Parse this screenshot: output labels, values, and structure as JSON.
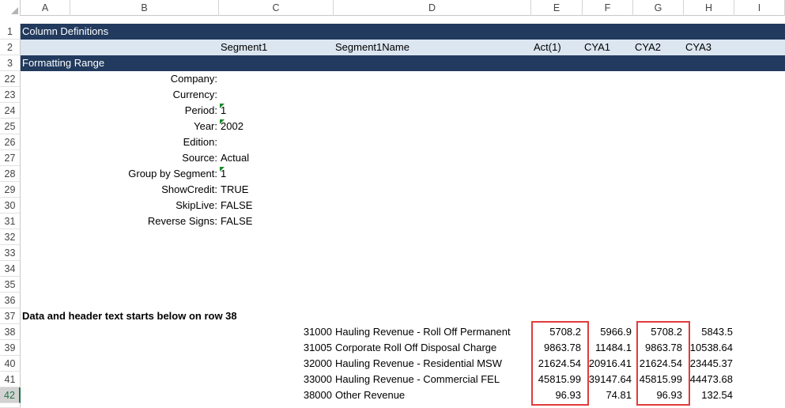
{
  "columns": [
    "A",
    "B",
    "C",
    "D",
    "E",
    "F",
    "G",
    "H",
    "I"
  ],
  "rows": {
    "r1": {
      "num": "1",
      "text": "Column Definitions"
    },
    "r2": {
      "num": "2",
      "c": "Segment1",
      "d": "Segment1Name",
      "e": "Act(1)",
      "f": "CYA1",
      "g": "CYA2",
      "h": "CYA3"
    },
    "r3": {
      "num": "3",
      "text": "Formatting Range"
    },
    "params": [
      {
        "num": "22",
        "label": "Company:",
        "value": ""
      },
      {
        "num": "23",
        "label": "Currency:",
        "value": ""
      },
      {
        "num": "24",
        "label": "Period:",
        "value": "1",
        "marker": true
      },
      {
        "num": "25",
        "label": "Year:",
        "value": "2002",
        "marker": true
      },
      {
        "num": "26",
        "label": "Edition:",
        "value": ""
      },
      {
        "num": "27",
        "label": "Source:",
        "value": "Actual"
      },
      {
        "num": "28",
        "label": "Group by Segment:",
        "value": "1",
        "marker": true
      },
      {
        "num": "29",
        "label": "ShowCredit:",
        "value": "TRUE"
      },
      {
        "num": "30",
        "label": "SkipLive:",
        "value": "FALSE"
      },
      {
        "num": "31",
        "label": "Reverse Signs:",
        "value": "FALSE"
      }
    ],
    "empty": [
      "32",
      "33",
      "34",
      "35",
      "36"
    ],
    "r37": {
      "num": "37",
      "text": "Data and header text starts below on row 38"
    },
    "data": [
      {
        "num": "38",
        "code": "31000",
        "name": "Hauling Revenue - Roll Off Permanent",
        "e": "5708.2",
        "f": "5966.9",
        "g": "5708.2",
        "h": "5843.5"
      },
      {
        "num": "39",
        "code": "31005",
        "name": "Corporate Roll Off Disposal Charge",
        "e": "9863.78",
        "f": "11484.1",
        "g": "9863.78",
        "h": "10538.64"
      },
      {
        "num": "40",
        "code": "32000",
        "name": "Hauling Revenue - Residential MSW",
        "e": "21624.54",
        "f": "20916.41",
        "g": "21624.54",
        "h": "23445.37"
      },
      {
        "num": "41",
        "code": "33000",
        "name": "Hauling Revenue - Commercial FEL",
        "e": "45815.99",
        "f": "39147.64",
        "g": "45815.99",
        "h": "44473.68"
      },
      {
        "num": "42",
        "code": "38000",
        "name": "Other Revenue",
        "e": "96.93",
        "f": "74.81",
        "g": "96.93",
        "h": "132.54"
      }
    ]
  },
  "colors": {
    "header_band": "#213a5e",
    "light_band": "#dce6f1",
    "highlight_box": "#e23b3b",
    "selection": "#217346"
  }
}
